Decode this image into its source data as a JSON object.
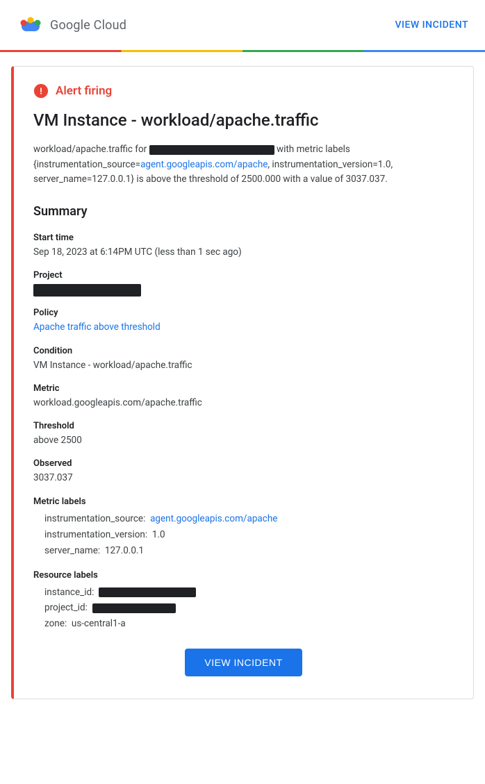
{
  "header": {
    "logo_text": "Google Cloud",
    "view_incident_label": "VIEW INCIDENT"
  },
  "alert": {
    "firing_label": "Alert firing",
    "title": "VM Instance - workload/apache.traffic",
    "description_prefix": "workload/apache.traffic for",
    "description_suffix": "with metric labels {instrumentation_source=",
    "agent_link": "agent.googleapis.com/apache",
    "description_rest": ", instrumentation_version=1.0, server_name=127.0.0.1} is above the threshold of 2500.000 with a value of 3037.037.",
    "summary_heading": "Summary",
    "start_time_label": "Start time",
    "start_time_value": "Sep 18, 2023 at 6:14PM UTC (less than 1 sec ago)",
    "project_label": "Project",
    "policy_label": "Policy",
    "policy_value": "Apache traffic above threshold",
    "condition_label": "Condition",
    "condition_value": "VM Instance - workload/apache.traffic",
    "metric_label": "Metric",
    "metric_value": "workload.googleapis.com/apache.traffic",
    "threshold_label": "Threshold",
    "threshold_value": "above 2500",
    "observed_label": "Observed",
    "observed_value": "3037.037",
    "metric_labels_heading": "Metric labels",
    "instrumentation_source_label": "instrumentation_source:",
    "instrumentation_source_link": "agent.googleapis.com/apache",
    "instrumentation_version_label": "instrumentation_version:",
    "instrumentation_version_value": "1.0",
    "server_name_label": "server_name:",
    "server_name_value": "127.0.0.1",
    "resource_labels_heading": "Resource labels",
    "instance_id_label": "instance_id:",
    "project_id_label": "project_id:",
    "zone_label": "zone:",
    "zone_value": "us-central1-a",
    "view_incident_btn": "VIEW INCIDENT"
  }
}
